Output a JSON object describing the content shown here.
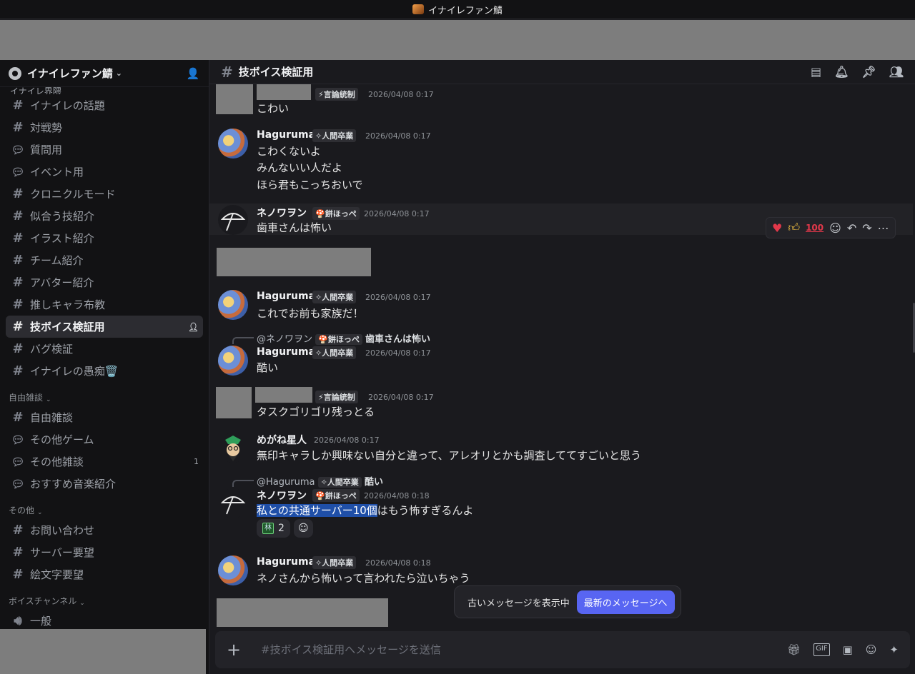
{
  "window": {
    "title": "イナイレファン鯖"
  },
  "server": {
    "name": "イナイレファン鯖"
  },
  "sidebar": {
    "top_partial": "イナイレ界隈",
    "channels_main": [
      {
        "label": "イナイレの話題",
        "kind": "text"
      },
      {
        "label": "対戦勢",
        "kind": "text"
      },
      {
        "label": "質問用",
        "kind": "forum"
      },
      {
        "label": "イベント用",
        "kind": "forum"
      },
      {
        "label": "クロニクルモード",
        "kind": "text"
      },
      {
        "label": "似合う技紹介",
        "kind": "text"
      },
      {
        "label": "イラスト紹介",
        "kind": "text"
      },
      {
        "label": "チーム紹介",
        "kind": "text"
      },
      {
        "label": "アバター紹介",
        "kind": "text"
      },
      {
        "label": "推しキャラ布教",
        "kind": "text"
      },
      {
        "label": "技ボイス検証用",
        "kind": "text",
        "active": true
      },
      {
        "label": "バグ検証",
        "kind": "text"
      },
      {
        "label": "イナイレの愚痴🗑️",
        "kind": "text"
      }
    ],
    "cat_free": "自由雑談",
    "channels_free": [
      {
        "label": "自由雑談",
        "kind": "text"
      },
      {
        "label": "その他ゲーム",
        "kind": "forum"
      },
      {
        "label": "その他雑談",
        "kind": "forum",
        "badge": "1"
      },
      {
        "label": "おすすめ音楽紹介",
        "kind": "forum"
      }
    ],
    "cat_other": "その他",
    "channels_other": [
      {
        "label": "お問い合わせ",
        "kind": "text"
      },
      {
        "label": "サーバー要望",
        "kind": "text"
      },
      {
        "label": "絵文字要望",
        "kind": "text"
      }
    ],
    "cat_voice": "ボイスチャンネル",
    "voice_partial": "一般"
  },
  "channel": {
    "name": "技ボイス検証用",
    "composer_placeholder": "#技ボイス検証用へメッセージを送信"
  },
  "messages": [
    {
      "id": "m1",
      "user": "",
      "tag": "⚡言論統制",
      "time": "2026/04/08 0:17",
      "lines": [
        "こわい"
      ]
    },
    {
      "id": "m2",
      "user": "Haguruma",
      "tag": "✧人間卒業",
      "time": "2026/04/08 0:17",
      "lines": [
        "こわくないよ",
        "みんないい人だよ",
        "ほら君もこっちおいで"
      ]
    },
    {
      "id": "m3",
      "user": "ネノワヲン",
      "tag": "🍄餅ほっぺ",
      "time": "2026/04/08 0:17",
      "lines": [
        "歯車さんは怖い"
      ]
    },
    {
      "id": "m4",
      "user": "Haguruma",
      "tag": "✧人間卒業",
      "time": "2026/04/08 0:17",
      "lines": [
        "これでお前も家族だ！"
      ]
    },
    {
      "id": "m5",
      "reply": {
        "user": "@ネノワヲン",
        "tag": "🍄餅ほっぺ",
        "text": "歯車さんは怖い"
      },
      "user": "Haguruma",
      "tag": "✧人間卒業",
      "time": "2026/04/08 0:17",
      "lines": [
        "酷い"
      ]
    },
    {
      "id": "m6",
      "user": "",
      "tag": "⚡言論統制",
      "time": "2026/04/08 0:17",
      "lines": [
        "タスクゴリゴリ残っとる"
      ]
    },
    {
      "id": "m7",
      "user": "めがね星人",
      "time": "2026/04/08 0:17",
      "lines": [
        "無印キャラしか興味ない自分と違って、アレオリとかも調査しててすごいと思う"
      ]
    },
    {
      "id": "m8",
      "reply": {
        "user": "@Haguruma",
        "tag": "✧人間卒業",
        "text": "酷い"
      },
      "user": "ネノワヲン",
      "tag": "🍄餅ほっぺ",
      "time": "2026/04/08 0:18",
      "selected": "私との共通サーバー10個",
      "rest": "はもう怖すぎるんよ",
      "reaction": {
        "emoji": "林",
        "count": "2"
      }
    },
    {
      "id": "m9",
      "user": "Haguruma",
      "tag": "✧人間卒業",
      "time": "2026/04/08 0:18",
      "lines": [
        "ネノさんから怖いって言われたら泣いちゃう"
      ]
    }
  ],
  "jump": {
    "status": "古いメッセージを表示中",
    "button": "最新のメッセージへ"
  },
  "toolbar": {
    "hundred": "100"
  },
  "icons": [
    "threads-icon",
    "bell-icon",
    "pin-icon",
    "members-icon",
    "gift-icon",
    "gif-icon",
    "sticker-icon",
    "emoji-icon",
    "apps-icon"
  ],
  "composer": {
    "gif": "GIF"
  }
}
